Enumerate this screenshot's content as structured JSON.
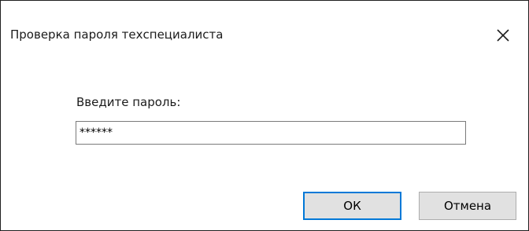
{
  "window": {
    "title": "Проверка пароля техспециалиста",
    "close_icon": "close-icon"
  },
  "form": {
    "prompt_label": "Введите пароль:",
    "password_value": "******"
  },
  "buttons": {
    "ok_label": "ОК",
    "cancel_label": "Отмена"
  },
  "colors": {
    "default_button_border": "#0078d7",
    "button_background": "#e1e1e1"
  }
}
